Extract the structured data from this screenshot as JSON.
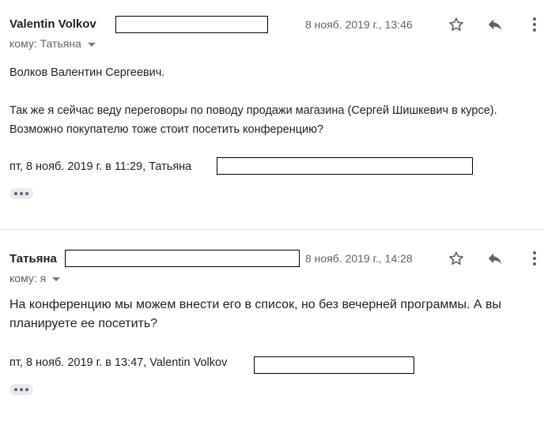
{
  "messages": [
    {
      "sender": "Valentin Volkov",
      "date": "8 нояб. 2019 г., 13:46",
      "to_label": "кому: Татьяна",
      "body": [
        "Волков Валентин Сергеевич.",
        "Так же я сейчас веду переговоры по поводу продажи магазина (Сергей Шишкевич в курсе). Возможно покупателю тоже стоит посетить конференцию?"
      ],
      "quote_header": "пт, 8 нояб. 2019 г. в 11:29, Татьяна"
    },
    {
      "sender": "Татьяна",
      "date": "8 нояб. 2019 г., 14:28",
      "to_label": "кому: я",
      "body": [
        "На конференцию мы можем внести его в список, но без вечерней программы. А вы планируете ее посетить?"
      ],
      "quote_header": "пт, 8 нояб. 2019 г. в 13:47, Valentin Volkov"
    }
  ],
  "icons": {
    "star": "star-icon",
    "reply": "reply-icon",
    "more": "more-vert-icon",
    "expand": "ellipsis-icon"
  },
  "colors": {
    "text": "#222222",
    "secondary": "#5f6368",
    "chip": "#e8eaed",
    "divider": "#e5e5e5"
  }
}
